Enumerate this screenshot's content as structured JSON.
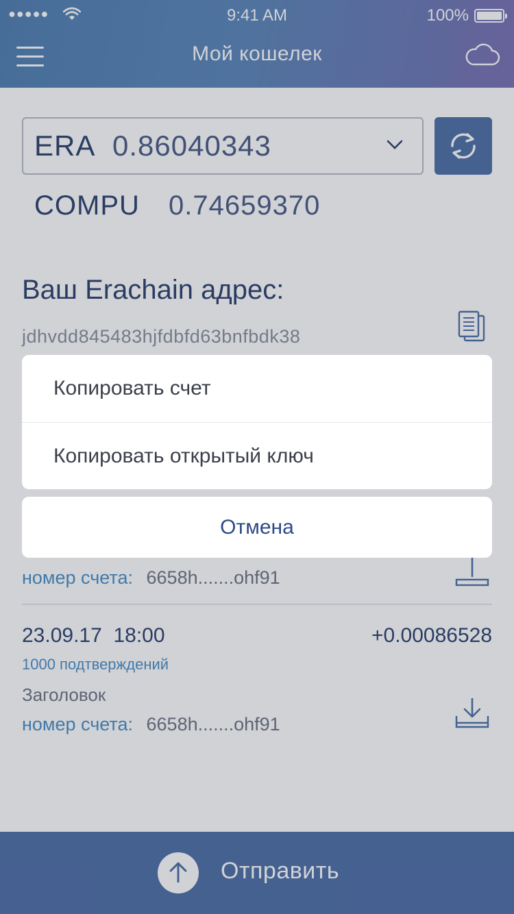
{
  "status_bar": {
    "signal": "●●●●●",
    "time": "9:41 AM",
    "battery": "100%"
  },
  "header": {
    "title": "Мой кошелек",
    "menu_icon": "hamburger-menu-icon",
    "cloud_icon": "cloud-icon"
  },
  "wallet": {
    "selected_currency": {
      "code": "ERA",
      "amount": "0.86040343"
    },
    "second_balance": {
      "code": "COMPU",
      "amount": "0.74659370"
    },
    "address_label": "Ваш Erachain адрес:",
    "address": "jdhvdd845483hjfdbfd63bnfbdk38"
  },
  "transactions": [
    {
      "date": "",
      "time": "",
      "amount": "",
      "confirmations": "",
      "title": "",
      "account_label": "номер счета:",
      "account_value": "6658h.......ohf91"
    },
    {
      "date": "23.09.17",
      "time": "18:00",
      "amount": "+0.00086528",
      "confirmations": "1000 подтверждений",
      "title": "Заголовок",
      "account_label": "номер счета:",
      "account_value": "6658h.......ohf91"
    }
  ],
  "footer": {
    "send_label": "Отправить"
  },
  "action_sheet": {
    "items": [
      {
        "label": "Копировать счет"
      },
      {
        "label": "Копировать открытый ключ"
      }
    ],
    "cancel_label": "Отмена"
  },
  "colors": {
    "header_start": "#4f7db0",
    "header_end": "#7a6fb2",
    "accent": "#4e6fa6",
    "text_primary": "#2c3f6b",
    "link": "#4a8ec6"
  }
}
